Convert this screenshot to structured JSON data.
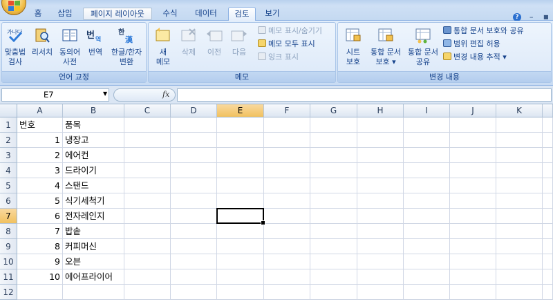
{
  "tabs": [
    {
      "label": "홈"
    },
    {
      "label": "삽입"
    },
    {
      "label": "페이지 레이아웃"
    },
    {
      "label": "수식"
    },
    {
      "label": "데이터"
    },
    {
      "label": "검토"
    },
    {
      "label": "보기"
    }
  ],
  "active_tab": "검토",
  "window": {
    "help": "?",
    "minimize": "–",
    "close": "■"
  },
  "ribbon": {
    "proofing": {
      "label": "언어 교정",
      "spell_check": "맞춤법\n검사",
      "research": "리서치",
      "thesaurus": "동의어\n사전",
      "translate": "번역",
      "hangul_hanja": "한글/한자\n변환"
    },
    "comments": {
      "label": "메모",
      "new_comment": "새\n메모",
      "delete": "삭제",
      "previous": "이전",
      "next": "다음",
      "show_hide": "메모 표시/숨기기",
      "show_all": "메모 모두 표시",
      "show_ink": "잉크 표시"
    },
    "changes": {
      "label": "변경 내용",
      "protect_sheet": "시트\n보호",
      "protect_workbook": "통합 문서\n보호 ▾",
      "share_workbook": "통합 문서\n공유",
      "protect_share": "통합 문서 보호와 공유",
      "allow_edit_ranges": "범위 편집 허용",
      "track_changes": "변경 내용 추적 ▾"
    }
  },
  "formula_bar": {
    "name_box": "E7",
    "fx": "fx",
    "value": ""
  },
  "columns": [
    "A",
    "B",
    "C",
    "D",
    "E",
    "F",
    "G",
    "H",
    "I",
    "J",
    "K"
  ],
  "rows": [
    "1",
    "2",
    "3",
    "4",
    "5",
    "6",
    "7",
    "8",
    "9",
    "10",
    "11",
    "12"
  ],
  "selected_cell": {
    "col": "E",
    "row": "7"
  },
  "cells": [
    {
      "col": "A",
      "row": "1",
      "value": "번호"
    },
    {
      "col": "B",
      "row": "1",
      "value": "품목"
    },
    {
      "col": "A",
      "row": "2",
      "value": "1"
    },
    {
      "col": "B",
      "row": "2",
      "value": "냉장고"
    },
    {
      "col": "A",
      "row": "3",
      "value": "2"
    },
    {
      "col": "B",
      "row": "3",
      "value": "에어컨"
    },
    {
      "col": "A",
      "row": "4",
      "value": "3"
    },
    {
      "col": "B",
      "row": "4",
      "value": "드라이기"
    },
    {
      "col": "A",
      "row": "5",
      "value": "4"
    },
    {
      "col": "B",
      "row": "5",
      "value": "스탠드"
    },
    {
      "col": "A",
      "row": "6",
      "value": "5"
    },
    {
      "col": "B",
      "row": "6",
      "value": "식기세척기"
    },
    {
      "col": "A",
      "row": "7",
      "value": "6"
    },
    {
      "col": "B",
      "row": "7",
      "value": "전자레인지"
    },
    {
      "col": "A",
      "row": "8",
      "value": "7"
    },
    {
      "col": "B",
      "row": "8",
      "value": "밥솥"
    },
    {
      "col": "A",
      "row": "9",
      "value": "8"
    },
    {
      "col": "B",
      "row": "9",
      "value": "커피머신"
    },
    {
      "col": "A",
      "row": "10",
      "value": "9"
    },
    {
      "col": "B",
      "row": "10",
      "value": "오븐"
    },
    {
      "col": "A",
      "row": "11",
      "value": "10"
    },
    {
      "col": "B",
      "row": "11",
      "value": "에어프라이어"
    }
  ]
}
